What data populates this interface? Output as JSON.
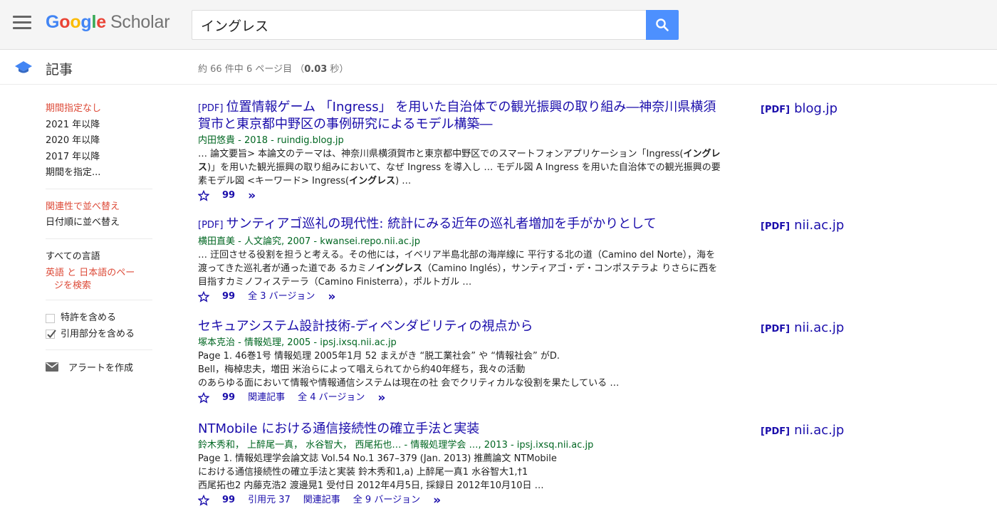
{
  "header": {
    "logo": {
      "google": "Google",
      "scholar": "Scholar"
    },
    "search": {
      "value": "イングレス"
    }
  },
  "subheader": {
    "section_label": "記事",
    "stats_prefix": "約 66 件中 6 ページ目 （",
    "stats_time": "0.03",
    "stats_suffix": " 秒）"
  },
  "sidebar": {
    "date_filters": [
      "期間指定なし",
      "2021 年以降",
      "2020 年以降",
      "2017 年以降",
      "期間を指定..."
    ],
    "sort": [
      "関連性で並べ替え",
      "日付順に並べ替え"
    ],
    "language": {
      "all": "すべての言語",
      "search_line1": "英語 と 日本語のペー",
      "search_line2": "ジを検索"
    },
    "include_patents": "特許を含める",
    "include_citations": "引用部分を含める",
    "create_alert": "アラートを作成"
  },
  "results": [
    {
      "pdf_tag": "[PDF]",
      "title": "位置情報ゲーム 「Ingress」 を用いた自治体での観光振興の取り組み―神奈川県横須賀市と東京都中野区の事例研究によるモデル構築―",
      "meta": "内田悠貴 - 2018 - ruindig.blog.jp",
      "snippet_a": "… 論文要旨> 本論文のテーマは、神奈川県横須賀市と東京都中野区でのスマートフォンアプリケーション「Ingress(",
      "snippet_b": "イングレス",
      "snippet_c": ")」を用いた観光振興の取り組みにおいて、なぜ Ingress を導入し … モデル図 A Ingress を用いた自治体での観光振興の要素モデル図 <キーワード> Ingress(",
      "snippet_d": "イングレス",
      "snippet_e": ") …",
      "side_pdf": "[PDF]",
      "side_domain": "blog.jp"
    },
    {
      "pdf_tag": "[PDF]",
      "title": "サンティアゴ巡礼の現代性: 統計にみる近年の巡礼者増加を手がかりとして",
      "meta": "横田直美 - 人文論究, 2007 - kwansei.repo.nii.ac.jp",
      "snippet_a": "… 迂回させる役割を担うと考える。その他には，イベリア半島北部の海岸線に 平行する北の道（Camino del Norte），海を渡ってきた巡礼者が通った道であ るカミノ",
      "snippet_b": "イングレス",
      "snippet_c": "（Camino Inglés），サンティアゴ・デ・コンポステラよ りさらに西を目指すカミノフィステーラ（Camino Finisterra），ポルトガル …",
      "versions": "全 3 バージョン",
      "side_pdf": "[PDF]",
      "side_domain": "nii.ac.jp"
    },
    {
      "title": "セキュアシステム設計技術-ディペンダビリティの視点から",
      "meta": "塚本克治 - 情報処理, 2005 - ipsj.ixsq.nii.ac.jp",
      "snippet_line1": "Page 1. 46巻1号 情報処理 2005年1月 52 まえがき “脱工業社会” や “情報社会” がD.",
      "snippet_line2": "Bell，梅棹忠夫，増田 米治らによって唱えられてから約40年経ち，我々の活動",
      "snippet_line3": "のあらゆる面において情報や情報通信システムは現在の社 会でクリティカルな役割を果たしている …",
      "related": "関連記事",
      "versions": "全 4 バージョン",
      "side_pdf": "[PDF]",
      "side_domain": "nii.ac.jp"
    },
    {
      "title": "NTMobile における通信接続性の確立手法と実装",
      "meta": "鈴木秀和， 上醉尾一真， 水谷智大， 西尾拓也… - 情報処理学会 …, 2013 - ipsj.ixsq.nii.ac.jp",
      "snippet_line1": "Page 1. 情報処理学会論文誌 Vol.54 No.1 367–379 (Jan. 2013) 推薦論文 NTMobile",
      "snippet_line2": "における通信接続性の確立手法と実装 鈴木秀和1,a) 上醉尾一真1 水谷智大1,†1",
      "snippet_line3": "西尾拓也2 内藤克浩2 渡邊晃1 受付日 2012年4月5日, 採録日 2012年10月10日 …",
      "cited_by": "引用元 37",
      "related": "関連記事",
      "versions": "全 9 バージョン",
      "side_pdf": "[PDF]",
      "side_domain": "nii.ac.jp"
    }
  ],
  "actions": {
    "cite_glyph": "99",
    "more_glyph": "»"
  },
  "colors": {
    "link": "#1a0dab",
    "meta_green": "#006621",
    "active_red": "#dd4b39",
    "search_button": "#4d90fe"
  }
}
